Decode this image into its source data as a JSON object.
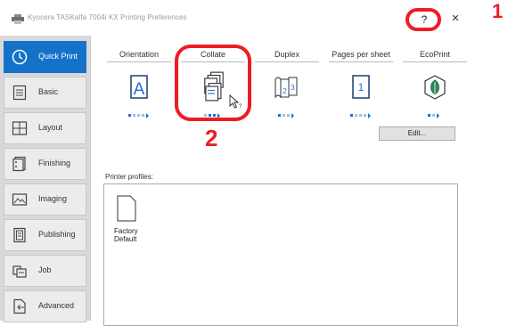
{
  "window": {
    "title": "Kyocera TASKalfa 7004i KX Printing Preferences",
    "help": "?",
    "close": "×"
  },
  "callouts": [
    "1",
    "2"
  ],
  "sidebar": {
    "items": [
      {
        "label": "Quick Print",
        "icon": "clock-icon",
        "active": true
      },
      {
        "label": "Basic",
        "icon": "document-lines-icon"
      },
      {
        "label": "Layout",
        "icon": "layout-grid-icon"
      },
      {
        "label": "Finishing",
        "icon": "finishing-icon"
      },
      {
        "label": "Imaging",
        "icon": "image-icon"
      },
      {
        "label": "Publishing",
        "icon": "publishing-icon"
      },
      {
        "label": "Job",
        "icon": "job-icon"
      },
      {
        "label": "Advanced",
        "icon": "advanced-icon"
      }
    ]
  },
  "quick_print": {
    "tabs": [
      {
        "label": "Orientation",
        "icon": "orientation-a-icon"
      },
      {
        "label": "Collate",
        "icon": "collate-icon"
      },
      {
        "label": "Duplex",
        "icon": "duplex-icon"
      },
      {
        "label": "Pages per sheet",
        "icon": "pages-per-sheet-icon"
      },
      {
        "label": "EcoPrint",
        "icon": "ecoprint-leaf-icon"
      }
    ],
    "orientation_letter": "A",
    "pages_per_sheet_value": "1",
    "edit_button": "Edit...",
    "profiles_label": "Printer profiles:",
    "profile_name_line1": "Factory",
    "profile_name_line2": "Default"
  },
  "colors": {
    "accent": "#1572c9",
    "callout": "#ee1c24"
  }
}
